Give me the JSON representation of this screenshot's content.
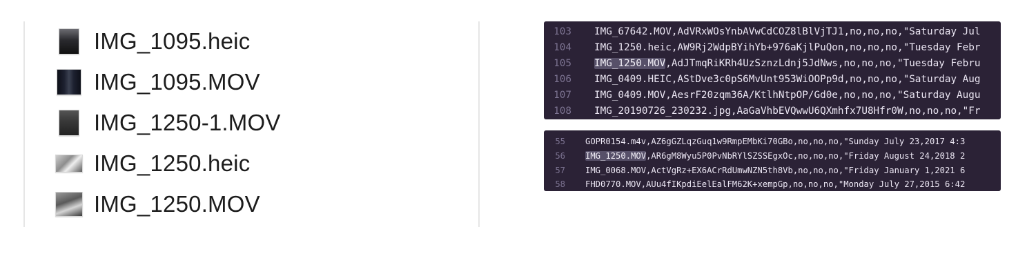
{
  "finder": {
    "files": [
      {
        "name": "IMG_1095.heic",
        "icon": "photo-thumbnail-icon",
        "kind": "portrait",
        "color": "#2a2a2e"
      },
      {
        "name": "IMG_1095.MOV",
        "icon": "video-thumbnail-icon",
        "kind": "portrait",
        "color": "#1d2130"
      },
      {
        "name": "IMG_1250-1.MOV",
        "icon": "video-thumbnail-icon",
        "kind": "portrait",
        "color": "#3a3a3a"
      },
      {
        "name": "IMG_1250.heic",
        "icon": "photo-thumbnail-icon",
        "kind": "landscape",
        "color": "#8d8d8d"
      },
      {
        "name": "IMG_1250.MOV",
        "icon": "video-thumbnail-icon",
        "kind": "landscape",
        "color": "#5a5a5a"
      }
    ]
  },
  "editor_top": {
    "lines": [
      {
        "num": "103",
        "highlight": "",
        "rest": "IMG_67642.MOV,AdVRxWOsYnbAVwCdCOZ8lBlVjTJ1,no,no,no,\"Saturday Jul"
      },
      {
        "num": "104",
        "highlight": "",
        "rest": "IMG_1250.heic,AW9Rj2WdpBYihYb+976aKjlPuQon,no,no,no,\"Tuesday Febr"
      },
      {
        "num": "105",
        "highlight": "IMG_1250.MOV",
        "rest": ",AdJTmqRiKRh4UzSznzLdnj5JdNws,no,no,no,\"Tuesday Febru"
      },
      {
        "num": "106",
        "highlight": "",
        "rest": "IMG_0409.HEIC,AStDve3c0pS6MvUnt953WiOOPp9d,no,no,no,\"Saturday Aug"
      },
      {
        "num": "107",
        "highlight": "",
        "rest": "IMG_0409.MOV,AesrF20zqm36A/KtlhNtpOP/Gd0e,no,no,no,\"Saturday Augu"
      },
      {
        "num": "108",
        "highlight": "",
        "rest": "IMG_20190726_230232.jpg,AaGaVhbEVQwwU6QXmhfx7U8Hfr0W,no,no,no,\"Fr"
      }
    ]
  },
  "editor_bottom": {
    "lines": [
      {
        "num": "55",
        "highlight": "",
        "rest": "GOPR0154.m4v,AZ6gGZLqzGuq1w9RmpEMbKi70GBo,no,no,no,\"Sunday July 23,2017 4:3"
      },
      {
        "num": "56",
        "highlight": "IMG_1250.MOV",
        "rest": ",AR6gM8Wyu5P0PvNbRYlSZSSEgxOc,no,no,no,\"Friday August 24,2018 2"
      },
      {
        "num": "57",
        "highlight": "",
        "rest": "IMG_0068.MOV,ActVgRz+EX6ACrRdUmwNZN5th8Vb,no,no,no,\"Friday January 1,2021 6"
      },
      {
        "num": "58",
        "highlight": "",
        "rest": "FHD0770.MOV,AUu4fIKpdiEelEalFM62K+xempGp,no,no,no,\"Monday July 27,2015 6:42"
      }
    ]
  },
  "colors": {
    "editor_bg": "#2b2236",
    "line_number": "#7c7391",
    "code_text": "#ebe6f3",
    "selection": "#575069"
  }
}
